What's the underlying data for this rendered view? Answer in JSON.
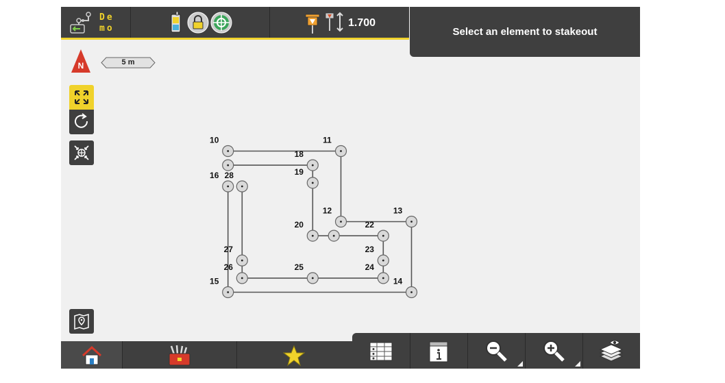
{
  "job": {
    "name": "De\nmo"
  },
  "instrument": {
    "height": "1.700"
  },
  "message": "Select an element to stakeout",
  "scale": {
    "label": "5 m"
  },
  "north": {
    "label": "N"
  },
  "colors": {
    "accent": "#f0d22b",
    "bar": "#3f3f3f",
    "map_bg": "#f0f0f0",
    "line": "#555555"
  },
  "points": [
    {
      "id": "10",
      "x": 2,
      "y": 10
    },
    {
      "id": "11",
      "x": 10,
      "y": 10
    },
    {
      "id": "18",
      "x": 8,
      "y": 9
    },
    {
      "id": "19",
      "x": 8,
      "y": 7.75
    },
    {
      "id": "16",
      "x": 2,
      "y": 7.5
    },
    {
      "id": "28",
      "x": 3,
      "y": 7.5
    },
    {
      "id": "12",
      "x": 10,
      "y": 5
    },
    {
      "id": "13",
      "x": 15,
      "y": 5
    },
    {
      "id": "20",
      "x": 8,
      "y": 4
    },
    {
      "id": "21",
      "x": 9.5,
      "y": 4
    },
    {
      "id": "22",
      "x": 13,
      "y": 4
    },
    {
      "id": "23",
      "x": 13,
      "y": 2.25
    },
    {
      "id": "27",
      "x": 3,
      "y": 2.25
    },
    {
      "id": "24",
      "x": 13,
      "y": 1
    },
    {
      "id": "26",
      "x": 3,
      "y": 1
    },
    {
      "id": "25",
      "x": 8,
      "y": 1
    },
    {
      "id": "15",
      "x": 2,
      "y": 0
    },
    {
      "id": "14",
      "x": 15,
      "y": 0
    }
  ],
  "lines": [
    [
      "10",
      "11"
    ],
    [
      "11",
      "12"
    ],
    [
      "12",
      "13"
    ],
    [
      "13",
      "14"
    ],
    [
      "14",
      "15"
    ],
    [
      "15",
      "16"
    ],
    [
      "17",
      "18"
    ],
    [
      "18",
      "19"
    ],
    [
      "19",
      "20"
    ],
    [
      "20",
      "21"
    ],
    [
      "21",
      "22"
    ],
    [
      "22",
      "23"
    ],
    [
      "23",
      "24"
    ],
    [
      "24",
      "25"
    ],
    [
      "25",
      "26"
    ],
    [
      "26",
      "27"
    ],
    [
      "27",
      "28"
    ]
  ],
  "extra_points": [
    {
      "id": "17",
      "x": 2,
      "y": 9,
      "label": ""
    }
  ],
  "label_offsets": {
    "10": "tl",
    "11": "tl",
    "18": "tl",
    "19": "tl",
    "16": "tl",
    "28": "t",
    "12": "tl",
    "13": "tl",
    "20": "tl",
    "21": "none",
    "22": "tl",
    "23": "tl",
    "27": "tl",
    "24": "tl",
    "26": "tl",
    "25": "tl",
    "15": "tl",
    "14": "bl",
    "17": "none"
  }
}
